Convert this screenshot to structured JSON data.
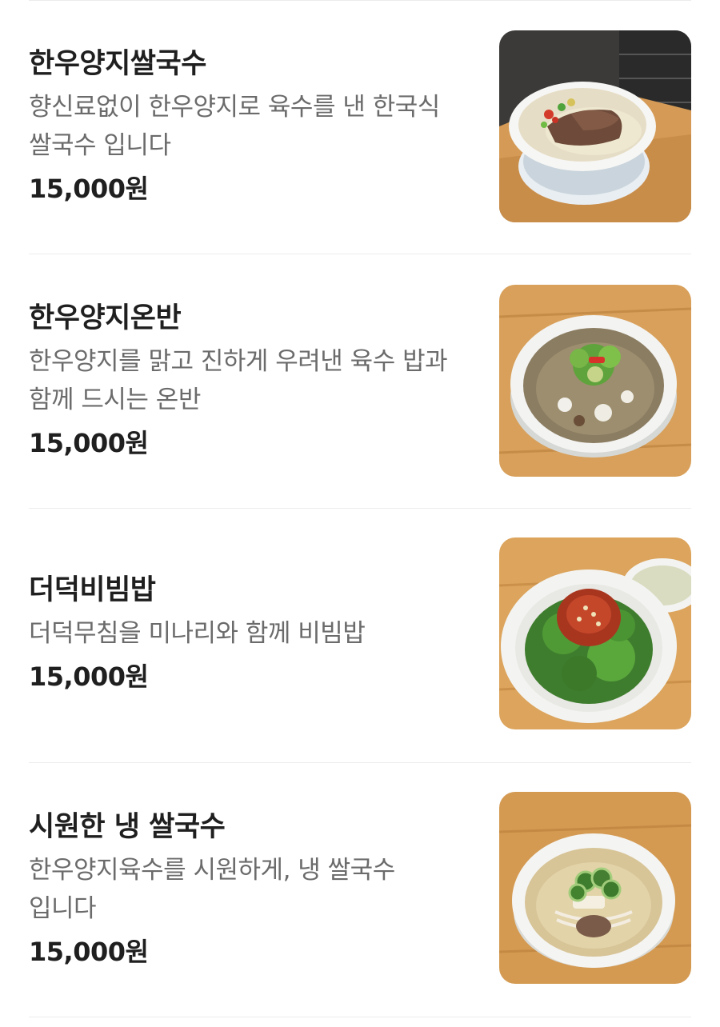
{
  "menu": {
    "items": [
      {
        "name": "한우양지쌀국수",
        "description": "향신료없이 한우양지로 육수를 낸 한국식 쌀국수 입니다",
        "price": "15,000원",
        "photo_icon": "beef-rice-noodle-soup-photo"
      },
      {
        "name": "한우양지온반",
        "description": "한우양지를 맑고 진하게 우려낸 육수 밥과 함께 드시는 온반",
        "price": "15,000원",
        "photo_icon": "beef-broth-rice-soup-photo"
      },
      {
        "name": "더덕비빔밥",
        "description": "더덕무침을 미나리와 함께 비빔밥",
        "price": "15,000원",
        "photo_icon": "deodeok-bibimbap-photo"
      },
      {
        "name": "시원한 냉 쌀국수",
        "description": "한우양지육수를 시원하게, 냉 쌀국수 입니다",
        "price": "15,000원",
        "photo_icon": "cold-rice-noodle-photo"
      }
    ]
  },
  "colors": {
    "text_primary": "#1f1f1f",
    "text_secondary": "#6b6b6b",
    "divider": "#ececec",
    "table_wood": "#d9a45f",
    "bowl_white": "#f4f4f2"
  }
}
